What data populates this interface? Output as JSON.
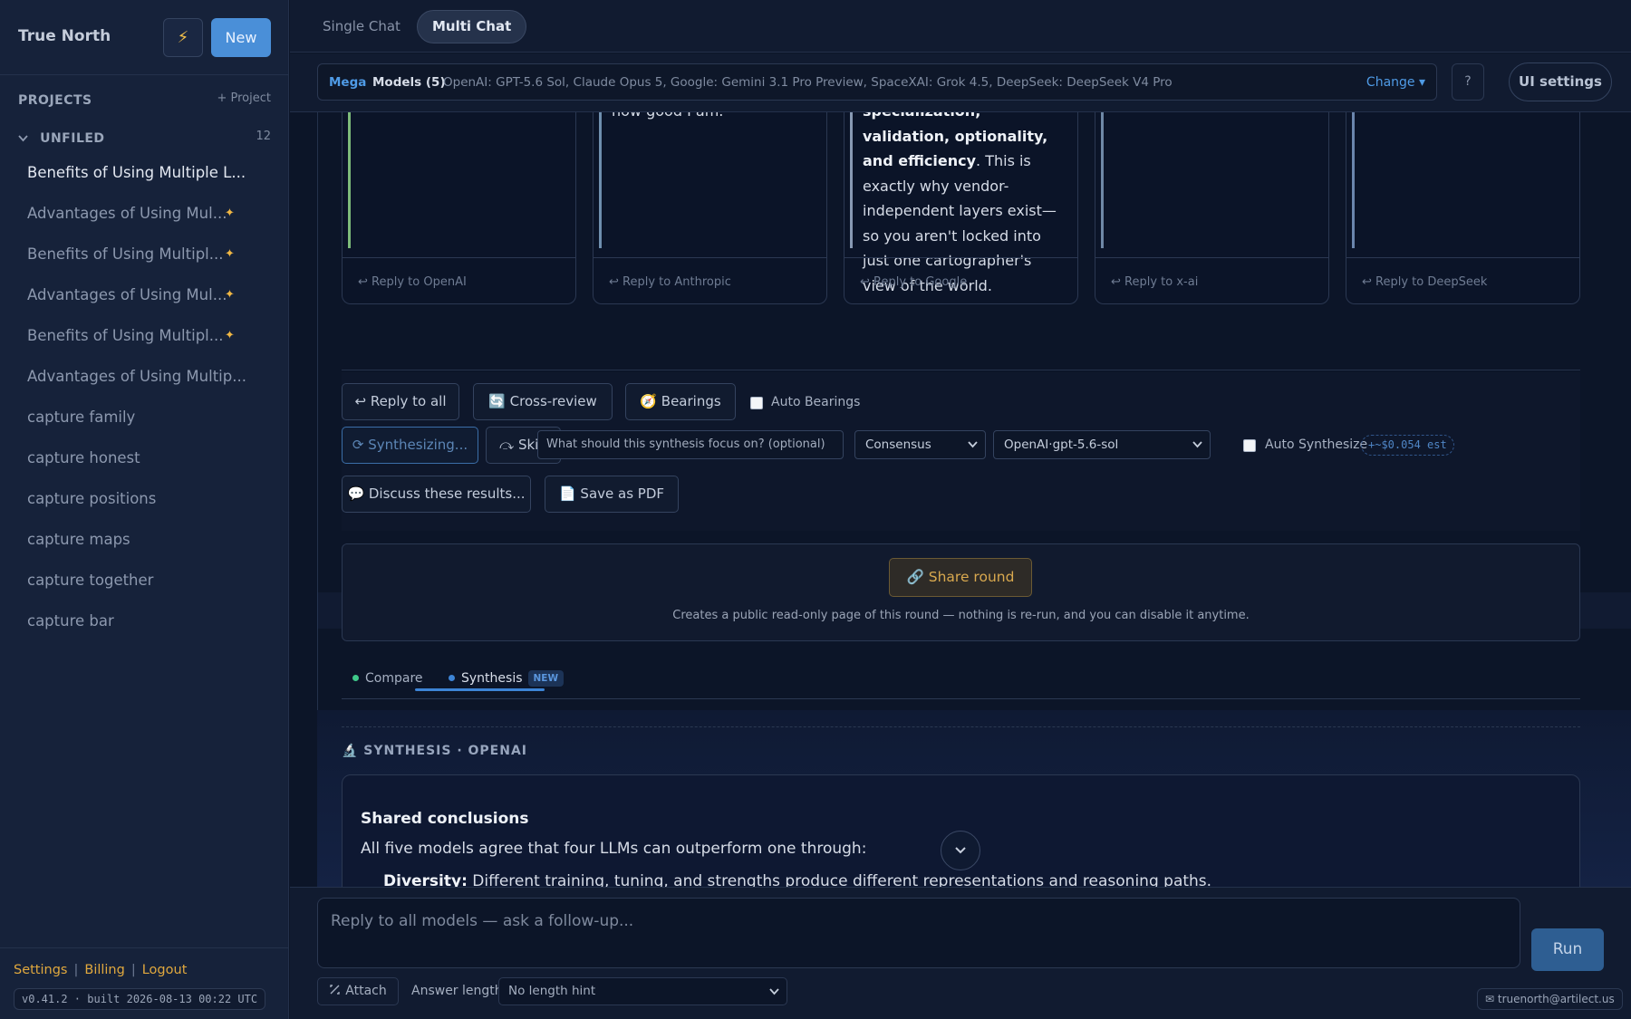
{
  "sidebar": {
    "brand": "True North",
    "bolt_icon": "⚡",
    "new_label": "New",
    "projects_label": "PROJECTS",
    "add_project_label": "+ Project",
    "unfiled_label": "UNFILED",
    "unfiled_count": "12",
    "chats": [
      {
        "title": "Benefits of Using Multiple L...",
        "starred": false
      },
      {
        "title": "Advantages of Using Mul...",
        "starred": true
      },
      {
        "title": "Benefits of Using Multipl...",
        "starred": true
      },
      {
        "title": "Advantages of Using Mul...",
        "starred": true
      },
      {
        "title": "Benefits of Using Multipl...",
        "starred": true
      },
      {
        "title": "Advantages of Using Multip...",
        "starred": false
      },
      {
        "title": "capture family",
        "starred": false
      },
      {
        "title": "capture honest",
        "starred": false
      },
      {
        "title": "capture positions",
        "starred": false
      },
      {
        "title": "capture maps",
        "starred": false
      },
      {
        "title": "capture together",
        "starred": false
      },
      {
        "title": "capture bar",
        "starred": false
      }
    ],
    "footer": {
      "settings": "Settings",
      "billing": "Billing",
      "logout": "Logout",
      "sep": "|",
      "build": "v0.41.2 · built 2026-08-13 00:22 UTC"
    }
  },
  "topbar": {
    "tab_single": "Single Chat",
    "tab_multi": "Multi Chat"
  },
  "modelbar": {
    "mega": "Mega",
    "models_count": "Models (5)",
    "models_list": "OpenAI: GPT-5.6 Sol, Claude Opus 5, Google: Gemini 3.1 Pro Preview, SpaceXAI: Grok 4.5, DeepSeek: DeepSeek V4 Pro",
    "change": "Change ▾",
    "help": "?",
    "ui_settings": "UI settings"
  },
  "cards": [
    {
      "reply": "↩ Reply to OpenAI",
      "accent": "#7dbb7a"
    },
    {
      "reply": "↩ Reply to Anthropic",
      "accent": "#6f8fae",
      "text": "how good I am."
    },
    {
      "reply": "↩ Reply to Google",
      "accent": "#8899b3",
      "bold": "specialization, validation, optionality, and efficiency",
      "text": ". This is exactly why vendor-independent layers exist—so you aren't locked into just one cartographer's view of the world."
    },
    {
      "reply": "↩ Reply to x-ai",
      "accent": "#6f88a6"
    },
    {
      "reply": "↩ Reply to DeepSeek",
      "accent": "#6b86ad"
    }
  ],
  "actions": {
    "reply_all": "↩ Reply to all",
    "cross_review": "🔄 Cross-review",
    "bearings": "🧭 Bearings",
    "auto_bearings": "Auto Bearings",
    "synthesizing": "⟳ Synthesizing...",
    "skip": "⤼ Skip",
    "focus_placeholder": "What should this synthesis focus on? (optional)",
    "mode_value": "Consensus",
    "model_value": "OpenAI·gpt-5.6-sol",
    "auto_synthesize": "Auto Synthesize",
    "estimate": "+~$0.054 est",
    "discuss": "💬 Discuss these results...",
    "save_pdf": "📄 Save as PDF"
  },
  "share": {
    "button": "🔗 Share round",
    "note": "Creates a public read-only page of this round — nothing is re-run, and you can disable it anytime."
  },
  "subtabs": {
    "compare": "Compare",
    "synthesis": "Synthesis",
    "new_badge": "NEW"
  },
  "synthesis": {
    "heading": "🔬 SYNTHESIS · OPENAI",
    "title": "Shared conclusions",
    "body": "All five models agree that four LLMs can outperform one through:",
    "bullet_bold": "Diversity:",
    "bullet_text": " Different training, tuning, and strengths produce different representations and reasoning paths."
  },
  "composer": {
    "placeholder": "Reply to all models — ask a follow-up...",
    "run": "Run",
    "attach": "Attach",
    "answer_length_label": "Answer length",
    "answer_length_value": "No length hint",
    "email": "✉ truenorth@artilect.us"
  },
  "colors": {
    "accent_blue": "#4a8fd8",
    "star": "#f0b744",
    "link_gold": "#e0a83e",
    "compare_dot": "#3fc98a",
    "synthesis_dot": "#3d84d6"
  }
}
